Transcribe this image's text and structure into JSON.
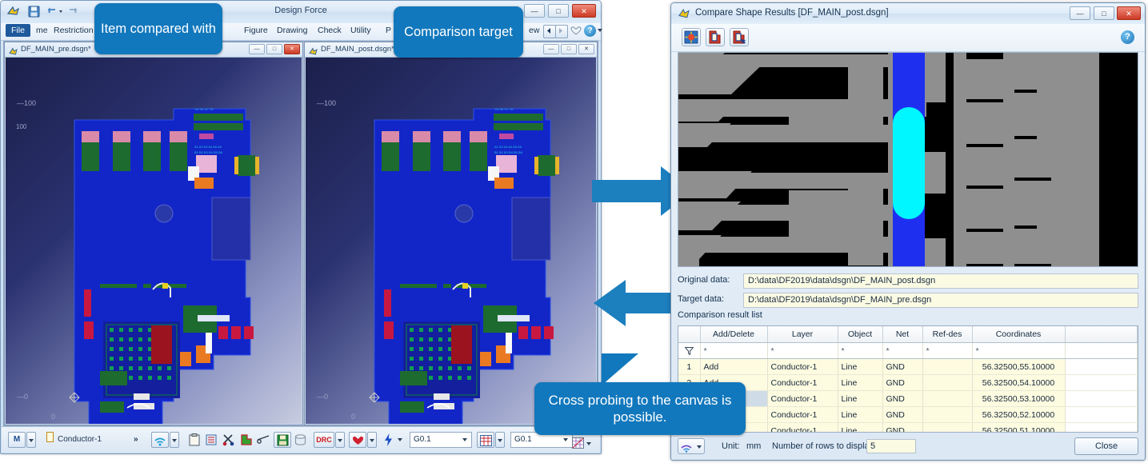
{
  "app": {
    "title": "Design Force",
    "menu": [
      "File",
      "me",
      "Restriction",
      "Figure",
      "Drawing",
      "Check",
      "Utility",
      "P",
      "ew"
    ],
    "window_buttons": [
      "minimize",
      "maximize",
      "close"
    ],
    "mdi": [
      {
        "label": "DF_MAIN_pre.dsgn*",
        "axis_y_top": "100",
        "axis_y_bottom": "0",
        "axis_x": "0"
      },
      {
        "label": "DF_MAIN_post.dsgn*",
        "axis_y_top": "100",
        "axis_y_bottom": "0",
        "axis_x": "0"
      }
    ],
    "statusbar": {
      "mode_icon": "M",
      "layer_label": "Conductor-1",
      "overflow": "»",
      "grid_value_1": "G0.1",
      "grid_value_2": "G0.1",
      "drc_label": "DRC",
      "overflow_2": "»"
    }
  },
  "dialog": {
    "title": "Compare Shape Results [DF_MAIN_post.dsgn]",
    "toolbar_icons": [
      "compare-icon",
      "copy-icon",
      "copy-select-icon"
    ],
    "help_glyph": "?",
    "original_data_label": "Original data:",
    "original_data_value": "D:\\data\\DF2019\\data\\dsgn\\DF_MAIN_post.dsgn",
    "target_data_label": "Target data:",
    "target_data_value": "D:\\data\\DF2019\\data\\dsgn\\DF_MAIN_pre.dsgn",
    "comparison_list_label": "Comparison result list",
    "table": {
      "columns": [
        "",
        "Add/Delete",
        "Layer",
        "Object",
        "Net",
        "Ref-des",
        "Coordinates",
        ""
      ],
      "filter_row": [
        "",
        "*",
        "*",
        "*",
        "*",
        "*",
        "*",
        ""
      ],
      "rows": [
        {
          "num": "1",
          "add_delete": "Add",
          "layer": "Conductor-1",
          "object": "Line",
          "net": "GND",
          "refdes": "",
          "coordinates": "56.32500,55.10000"
        },
        {
          "num": "2",
          "add_delete": "Add",
          "layer": "Conductor-1",
          "object": "Line",
          "net": "GND",
          "refdes": "",
          "coordinates": "56.32500,54.10000"
        },
        {
          "num": "",
          "add_delete": "",
          "layer": "Conductor-1",
          "object": "Line",
          "net": "GND",
          "refdes": "",
          "coordinates": "56.32500,53.10000"
        },
        {
          "num": "",
          "add_delete": "",
          "layer": "Conductor-1",
          "object": "Line",
          "net": "GND",
          "refdes": "",
          "coordinates": "56.32500,52.10000"
        },
        {
          "num": "",
          "add_delete": "",
          "layer": "Conductor-1",
          "object": "Line",
          "net": "GND",
          "refdes": "",
          "coordinates": "56.32500,51.10000"
        }
      ]
    },
    "bottom": {
      "unit_label": "Unit:",
      "unit_value": "mm",
      "rows_label": "Number of rows to display:",
      "rows_value": "5",
      "close_label": "Close"
    }
  },
  "callouts": {
    "item_compared": "Item compared with",
    "comparison_target": "Comparison target",
    "cross_probing": "Cross probing to the canvas is possible."
  },
  "colors": {
    "callout_blue": "#1278bd",
    "arrow_blue": "#1c7fbe",
    "highlight_cyan": "#00f7ff",
    "trace_blue": "#1f2ff0",
    "pad_gray": "#8f8f8f",
    "field_yellow": "#fbfbe4",
    "row_yellow": "#fdfbe0"
  }
}
